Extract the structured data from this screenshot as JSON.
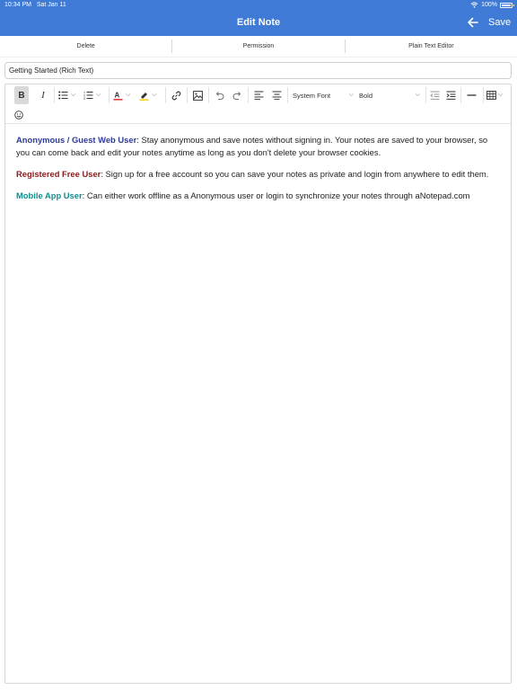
{
  "status_bar": {
    "time": "10:34 PM",
    "date": "Sat Jan 11",
    "battery": "100%",
    "battery_level": 1.0
  },
  "nav": {
    "title": "Edit Note",
    "back_icon": "arrow-left-icon",
    "save_label": "Save"
  },
  "tabs": [
    {
      "label": "Delete"
    },
    {
      "label": "Permission"
    },
    {
      "label": "Plain Text Editor"
    }
  ],
  "note_title": {
    "value": "Getting Started (Rich Text)"
  },
  "toolbar": {
    "font_family": "System Font",
    "font_weight": "Bold",
    "buttons": [
      "bold-icon",
      "italic-icon",
      "bullet-list-icon",
      "numbered-list-icon",
      "text-color-icon",
      "highlight-icon",
      "link-icon",
      "image-icon",
      "undo-icon",
      "redo-icon",
      "align-left-icon",
      "align-center-icon",
      "outdent-icon",
      "indent-icon",
      "horizontal-rule-icon",
      "table-icon",
      "emoji-icon"
    ],
    "colors": {
      "text_color_underline": "#e03b3b",
      "highlight_underline": "#f2d21c"
    }
  },
  "content": {
    "paragraphs": [
      {
        "label": "Anonymous / Guest Web User",
        "text": ": Stay anonymous and save notes without signing in. Your notes are saved to your browser, so you can come back and edit your notes anytime as long as you don't delete your browser cookies."
      },
      {
        "label": "Registered Free User",
        "text": ": Sign up for a free account so you can save your notes as private and login from anywhere to edit them."
      },
      {
        "label": "Mobile App User",
        "text": ": Can either work offline as a Anonymous user or login to synchronize your notes through aNotepad.com"
      }
    ]
  },
  "colors": {
    "accent": "#3f7bd6",
    "label_1": "#2e3b99",
    "label_2": "#8b1a1a",
    "label_3": "#128e8e"
  }
}
